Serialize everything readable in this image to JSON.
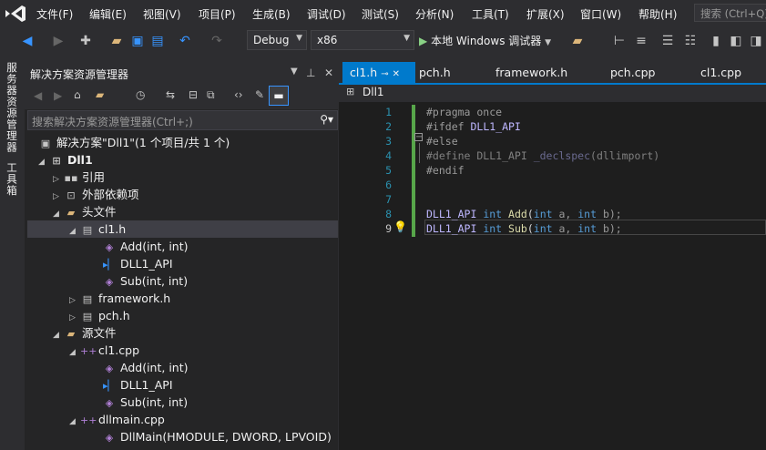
{
  "menu": [
    "文件(F)",
    "编辑(E)",
    "视图(V)",
    "项目(P)",
    "生成(B)",
    "调试(D)",
    "测试(S)",
    "分析(N)",
    "工具(T)",
    "扩展(X)",
    "窗口(W)",
    "帮助(H)"
  ],
  "search_placeholder": "搜索 (Ctrl+Q)",
  "toolbar": {
    "config": "Debug",
    "platform": "x86",
    "run_label": "本地 Windows 调试器"
  },
  "side_tabs": [
    "服务器资源管理器",
    "工具箱"
  ],
  "solution_explorer": {
    "title": "解决方案资源管理器",
    "search_placeholder": "搜索解决方案资源管理器(Ctrl+;)",
    "tree": [
      {
        "label": "解决方案\"Dll1\"(1 个项目/共 1 个)",
        "icon": "solution-icon"
      },
      {
        "label": "Dll1",
        "icon": "project-icon"
      },
      {
        "label": "引用",
        "icon": "references-icon"
      },
      {
        "label": "外部依赖项",
        "icon": "external-deps-icon"
      },
      {
        "label": "头文件",
        "icon": "folder-icon"
      },
      {
        "label": "cl1.h",
        "icon": "header-file-icon"
      },
      {
        "label": "Add(int, int)",
        "icon": "function-icon"
      },
      {
        "label": "DLL1_API",
        "icon": "macro-icon"
      },
      {
        "label": "Sub(int, int)",
        "icon": "function-icon"
      },
      {
        "label": "framework.h",
        "icon": "header-file-icon"
      },
      {
        "label": "pch.h",
        "icon": "header-file-icon"
      },
      {
        "label": "源文件",
        "icon": "folder-icon"
      },
      {
        "label": "cl1.cpp",
        "icon": "cpp-file-icon"
      },
      {
        "label": "Add(int, int)",
        "icon": "function-icon"
      },
      {
        "label": "DLL1_API",
        "icon": "macro-icon"
      },
      {
        "label": "Sub(int, int)",
        "icon": "function-icon"
      },
      {
        "label": "dllmain.cpp",
        "icon": "cpp-file-icon"
      },
      {
        "label": "DllMain(HMODULE, DWORD, LPVOID)",
        "icon": "function-icon"
      }
    ]
  },
  "editor": {
    "tabs": [
      "cl1.h",
      "pch.h",
      "framework.h",
      "pch.cpp",
      "cl1.cpp"
    ],
    "nav_scope": "Dll1",
    "line_numbers": [
      "1",
      "2",
      "3",
      "4",
      "5",
      "6",
      "7",
      "8",
      "9"
    ],
    "lines": [
      {
        "t1": "#pragma once"
      },
      {
        "t1": "#ifdef ",
        "t2": "DLL1_API"
      },
      {
        "t1": "#else"
      },
      {
        "t1": "#define DLL1_API ",
        "t2": "_declspec",
        "t3": "(dllimport)"
      },
      {
        "t1": "#endif"
      },
      {
        "t1": ""
      },
      {
        "t1": ""
      },
      {
        "mac": "DLL1_API",
        "kw1": "int",
        "fn": "Add",
        "p1": "(",
        "kw2": "int",
        "a": " a, ",
        "kw3": "int",
        "b": " b);"
      },
      {
        "mac": "DLL1_API",
        "kw1": "int",
        "fn": "Sub",
        "p1": "(",
        "kw2": "int",
        "a": " a, ",
        "kw3": "int",
        "b": " b);"
      }
    ]
  },
  "colors": {
    "accent": "#007acc",
    "bg": "#2d2d30",
    "editor_bg": "#1e1e1e"
  }
}
